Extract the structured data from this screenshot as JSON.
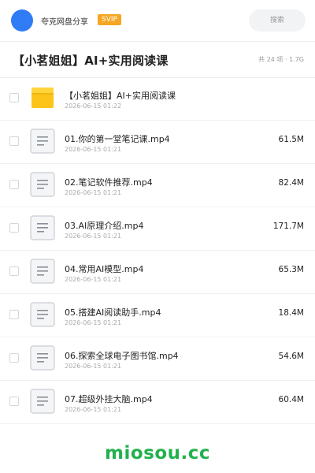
{
  "header": {
    "user_name": "夸克网盘分享",
    "badge": "SVIP",
    "search_placeholder": "搜索"
  },
  "title_bar": {
    "title": "【小茗姐姐】AI+实用阅读课",
    "meta": "共 24 项 · 1.7G"
  },
  "items": [
    {
      "type": "folder",
      "icon": "folder-icon",
      "name": "【小茗姐姐】AI+实用阅读课",
      "date": "2026-06-15 01:22",
      "size": ""
    },
    {
      "type": "file",
      "icon": "file-icon",
      "name": "01.你的第一堂笔记课.mp4",
      "date": "2026-06-15 01:21",
      "size": "61.5M"
    },
    {
      "type": "file",
      "icon": "file-icon",
      "name": "02.笔记软件推荐.mp4",
      "date": "2026-06-15 01:21",
      "size": "82.4M"
    },
    {
      "type": "file",
      "icon": "file-icon",
      "name": "03.AI原理介绍.mp4",
      "date": "2026-06-15 01:21",
      "size": "171.7M"
    },
    {
      "type": "file",
      "icon": "file-icon",
      "name": "04.常用AI模型.mp4",
      "date": "2026-06-15 01:21",
      "size": "65.3M"
    },
    {
      "type": "file",
      "icon": "file-icon",
      "name": "05.搭建AI阅读助手.mp4",
      "date": "2026-06-15 01:21",
      "size": "18.4M"
    },
    {
      "type": "file",
      "icon": "file-icon",
      "name": "06.探索全球电子图书馆.mp4",
      "date": "2026-06-15 01:21",
      "size": "54.6M"
    },
    {
      "type": "file",
      "icon": "file-icon",
      "name": "07.超级外挂大脑.mp4",
      "date": "2026-06-15 01:21",
      "size": "60.4M"
    }
  ],
  "watermark": "miosou.cc",
  "colors": {
    "accent": "#2f7cf6",
    "svip": "#f5a623",
    "folder": "#fcc419",
    "watermark": "#22b14c"
  }
}
